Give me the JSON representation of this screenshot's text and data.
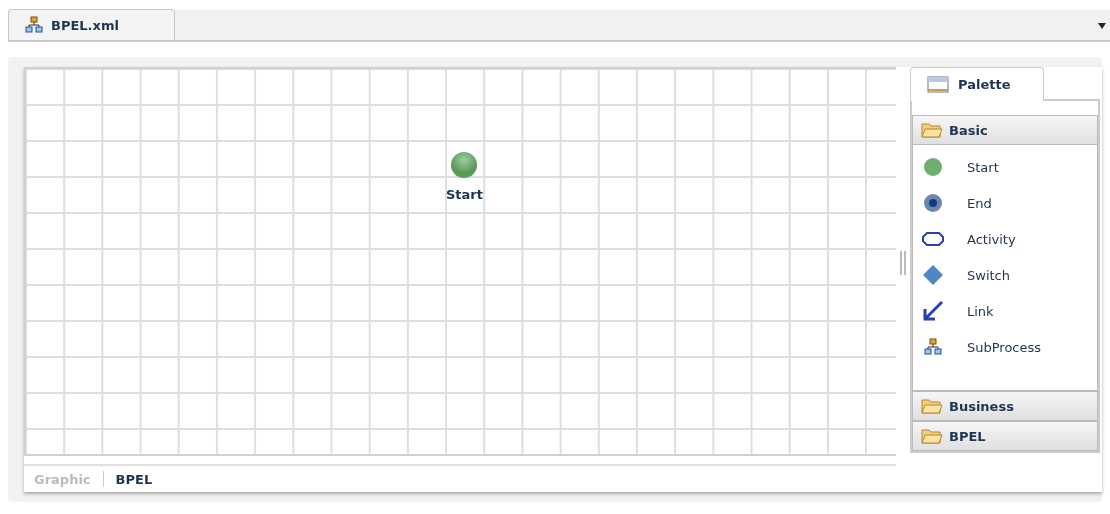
{
  "file_tabs": [
    {
      "label": "BPEL.xml",
      "selected": true
    }
  ],
  "canvas": {
    "nodes": [
      {
        "kind": "start",
        "label": "Start"
      }
    ]
  },
  "palette": {
    "title": "Palette",
    "groups": [
      {
        "label": "Basic",
        "items": [
          {
            "kind": "start",
            "label": "Start"
          },
          {
            "kind": "end",
            "label": "End"
          },
          {
            "kind": "activity",
            "label": "Activity"
          },
          {
            "kind": "switch",
            "label": "Switch"
          },
          {
            "kind": "link",
            "label": "Link"
          },
          {
            "kind": "subprocess",
            "label": "SubProcess"
          }
        ]
      },
      {
        "label": "Business"
      },
      {
        "label": "BPEL"
      }
    ]
  },
  "view_tabs": [
    {
      "label": "Graphic",
      "selected": false
    },
    {
      "label": "BPEL",
      "selected": true
    }
  ]
}
